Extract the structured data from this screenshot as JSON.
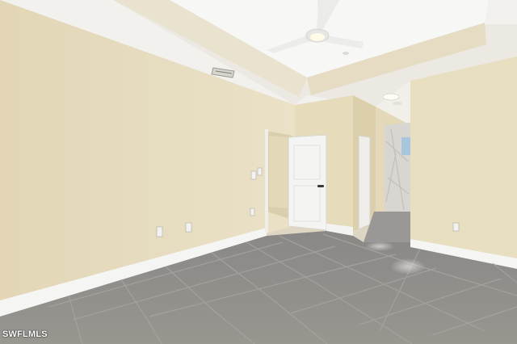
{
  "photo": {
    "watermark": "SWFLMLS",
    "colors": {
      "wall": "#e5dbbd",
      "wall_shadow": "#d7cca9",
      "ceiling": "#f3f2ef",
      "floor": "#8f8d8b",
      "floor_grout": "#a5a3a0",
      "baseboard": "#f5f5f3",
      "door": "#f4f4f2"
    },
    "icons": [
      "ceiling-fan-icon",
      "air-vent-icon",
      "recessed-light-icon",
      "door-handle-icon",
      "electrical-outlet-icon",
      "light-switch-icon"
    ]
  }
}
